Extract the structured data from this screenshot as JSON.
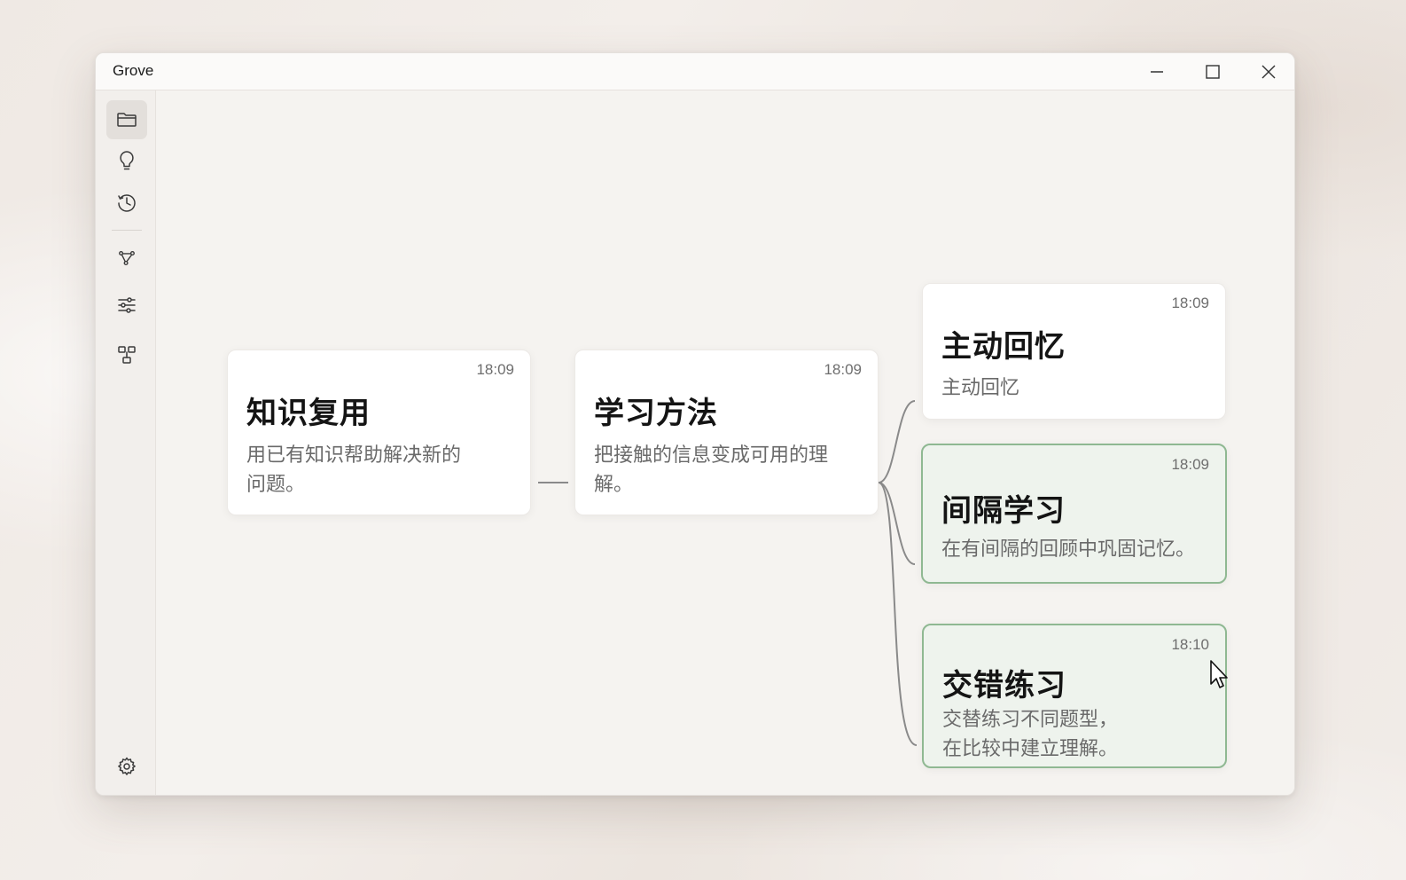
{
  "window": {
    "title": "Grove"
  },
  "sidebar": {
    "items": [
      {
        "name": "files",
        "icon": "folder-icon",
        "active": true
      },
      {
        "name": "ideas",
        "icon": "lightbulb-icon",
        "active": false
      },
      {
        "name": "history",
        "icon": "history-icon",
        "active": false
      },
      {
        "name": "graph",
        "icon": "graph-nodes-icon",
        "active": false
      },
      {
        "name": "filters",
        "icon": "sliders-icon",
        "active": false
      },
      {
        "name": "layout",
        "icon": "layout-tree-icon",
        "active": false
      }
    ],
    "settings_icon": "gear-icon"
  },
  "cards": [
    {
      "id": "zhishi",
      "title": "知识复用",
      "time": "18:09",
      "body_lines": [
        "用已有知识帮助解决新的",
        "问题。"
      ],
      "selected": false
    },
    {
      "id": "xuexi",
      "title": "学习方法",
      "time": "18:09",
      "body_lines": [
        "把接触的信息变成可用的理",
        "解。"
      ],
      "selected": false
    },
    {
      "id": "zhudong",
      "title": "主动回忆",
      "time": "18:09",
      "body_lines": [
        "主动回忆"
      ],
      "selected": false
    },
    {
      "id": "jiange",
      "title": "间隔学习",
      "time": "18:09",
      "body_lines": [
        "在有间隔的回顾中巩固记忆。"
      ],
      "selected": true
    },
    {
      "id": "jiaocuo",
      "title": "交错练习",
      "time": "18:10",
      "body_lines": [
        "交替练习不同题型，",
        "在比较中建立理解。"
      ],
      "selected": true
    }
  ],
  "colors": {
    "accent_border": "#8fb892",
    "selected_fill": "#eef3ed",
    "link_line": "#8a8a8a"
  }
}
